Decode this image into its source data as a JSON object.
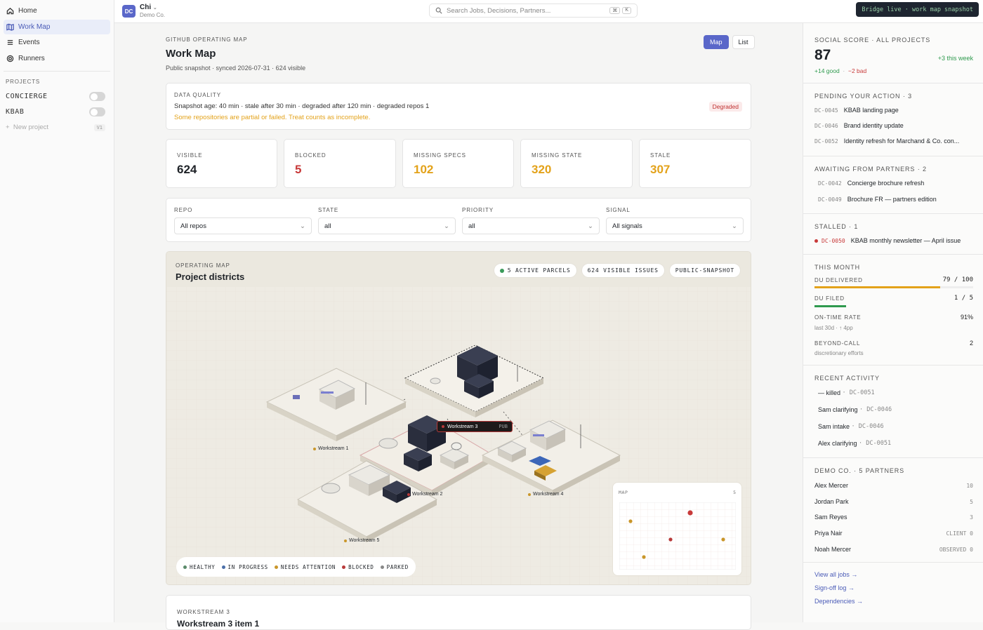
{
  "sidebar": {
    "nav": [
      {
        "label": "Home",
        "icon": "home-icon"
      },
      {
        "label": "Work Map",
        "icon": "map-icon"
      },
      {
        "label": "Events",
        "icon": "list-icon"
      },
      {
        "label": "Runners",
        "icon": "target-icon"
      }
    ],
    "projects_title": "PROJECTS",
    "projects": [
      {
        "label": "CONCIERGE"
      },
      {
        "label": "KBAB"
      }
    ],
    "new_project": "New project",
    "new_project_kbd": "V1"
  },
  "topbar": {
    "avatar": "DC",
    "user": "Chi",
    "org": "Demo Co.",
    "search_placeholder": "Search Jobs, Decisions, Partners...",
    "kbd": [
      "⌘",
      "K"
    ],
    "bridge": "Bridge live · work map snapshot"
  },
  "header": {
    "eyebrow": "GITHUB OPERATING MAP",
    "title": "Work Map",
    "subtitle": "Public snapshot · synced 2026-07-31 · 624 visible",
    "view_map": "Map",
    "view_list": "List"
  },
  "quality": {
    "title": "DATA QUALITY",
    "line": "Snapshot age: 40 min · stale after 30 min · degraded after 120 min · degraded repos 1",
    "warning": "Some repositories are partial or failed. Treat counts as incomplete.",
    "badge": "Degraded"
  },
  "stats": [
    {
      "label": "VISIBLE",
      "value": "624",
      "color": "#1f2328"
    },
    {
      "label": "BLOCKED",
      "value": "5",
      "color": "#c83a3a"
    },
    {
      "label": "MISSING SPECS",
      "value": "102",
      "color": "#e3a21a"
    },
    {
      "label": "MISSING STATE",
      "value": "320",
      "color": "#e3a21a"
    },
    {
      "label": "STALE",
      "value": "307",
      "color": "#e3a21a"
    }
  ],
  "filters": [
    {
      "label": "REPO",
      "value": "All repos"
    },
    {
      "label": "STATE",
      "value": "all"
    },
    {
      "label": "PRIORITY",
      "value": "all"
    },
    {
      "label": "SIGNAL",
      "value": "All signals"
    }
  ],
  "map": {
    "eyebrow": "OPERATING MAP",
    "title": "Project districts",
    "chips": [
      "5 ACTIVE PARCELS",
      "624 VISIBLE ISSUES",
      "PUBLIC-SNAPSHOT"
    ],
    "districts": [
      "Workstream 1",
      "Workstream 3",
      "Workstream 2",
      "Workstream 4",
      "Workstream 5"
    ],
    "selected_tag": "PUB",
    "legend": [
      {
        "label": "HEALTHY",
        "color": "#5a8a6a"
      },
      {
        "label": "IN PROGRESS",
        "color": "#4b6fa8"
      },
      {
        "label": "NEEDS ATTENTION",
        "color": "#c9962a"
      },
      {
        "label": "BLOCKED",
        "color": "#b83a3a"
      },
      {
        "label": "PARKED",
        "color": "#888888"
      }
    ],
    "minimap_title": "MAP",
    "minimap_count": "5"
  },
  "bottom": {
    "eyebrow": "WORKSTREAM 3",
    "title": "Workstream 3 item 1"
  },
  "right": {
    "score_title": "SOCIAL SCORE · ALL PROJECTS",
    "score": "87",
    "week": "+3 this week",
    "good": "+14 good",
    "bad": "−2 bad",
    "pending_title": "PENDING YOUR ACTION · 3",
    "pending": [
      {
        "id": "DC-0045",
        "text": "KBAB landing page"
      },
      {
        "id": "DC-0046",
        "text": "Brand identity update"
      },
      {
        "id": "DC-0052",
        "text": "Identity refresh for Marchand & Co. con..."
      }
    ],
    "awaiting_title": "AWAITING FROM PARTNERS · 2",
    "awaiting": [
      {
        "id": "DC-0042",
        "text": "Concierge brochure refresh"
      },
      {
        "id": "DC-0049",
        "text": "Brochure FR — partners edition"
      }
    ],
    "stalled_title": "STALLED · 1",
    "stalled": [
      {
        "id": "DC-0050",
        "text": "KBAB monthly newsletter — April issue"
      }
    ],
    "month_title": "THIS MONTH",
    "du_delivered": "DU DELIVERED",
    "du_delivered_val": "79 / 100",
    "du_delivered_frac": 0.79,
    "du_filed": "DU FILED",
    "du_filed_val": "1 / 5",
    "du_filed_frac": 0.2,
    "ontime": "ON-TIME RATE",
    "ontime_val": "91%",
    "ontime_sub": "last 30d · ↑ 4pp",
    "beyond": "BEYOND-CALL",
    "beyond_val": "2",
    "beyond_sub": "discretionary efforts",
    "activity_title": "RECENT ACTIVITY",
    "activity": [
      {
        "who": "— killed",
        "id": "· DC-0051"
      },
      {
        "who": "Sam clarifying",
        "id": "· DC-0046"
      },
      {
        "who": "Sam intake",
        "id": "· DC-0046"
      },
      {
        "who": "Alex clarifying",
        "id": "· DC-0051"
      }
    ],
    "partners_title": "DEMO CO. · 5 PARTNERS",
    "partners": [
      {
        "name": "Alex Mercer",
        "val": "10"
      },
      {
        "name": "Jordan Park",
        "val": "5"
      },
      {
        "name": "Sam Reyes",
        "val": "3"
      },
      {
        "name": "Priya Nair",
        "val": "CLIENT 0"
      },
      {
        "name": "Noah Mercer",
        "val": "OBSERVED 0"
      }
    ],
    "links": [
      "View all jobs →",
      "Sign-off log →",
      "Dependencies →"
    ]
  }
}
